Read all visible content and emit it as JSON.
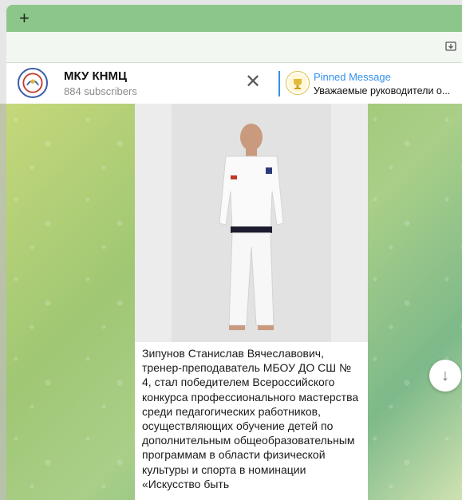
{
  "tabbar": {
    "new_tab_label": "+"
  },
  "header": {
    "channel_name": "МКУ КНМЦ",
    "subscribers": "884 subscribers",
    "close_label": "✕",
    "pinned_title": "Pinned Message",
    "pinned_text": "Уважаемые руководители о..."
  },
  "message": {
    "text": "Зипунов Станислав Вячеславович, тренер-преподаватель МБОУ ДО СШ № 4, стал победителем Всероссийского конкурса профессионального мастерства среди педагогических работников, осуществляющих обучение детей по дополнительным общеобразовательным программам в области физической культуры и спорта в номинации «Искусство быть"
  },
  "scroll_down_label": "↓",
  "colors": {
    "tab_green": "#8cc68a",
    "pinned_accent": "#3390ec",
    "chat_bg_start": "#c6d87a",
    "chat_bg_end": "#7eb98a"
  },
  "icons": [
    "plus-icon",
    "download-icon",
    "channel-avatar",
    "close-icon",
    "pinned-message-icon",
    "arrow-down-icon"
  ]
}
